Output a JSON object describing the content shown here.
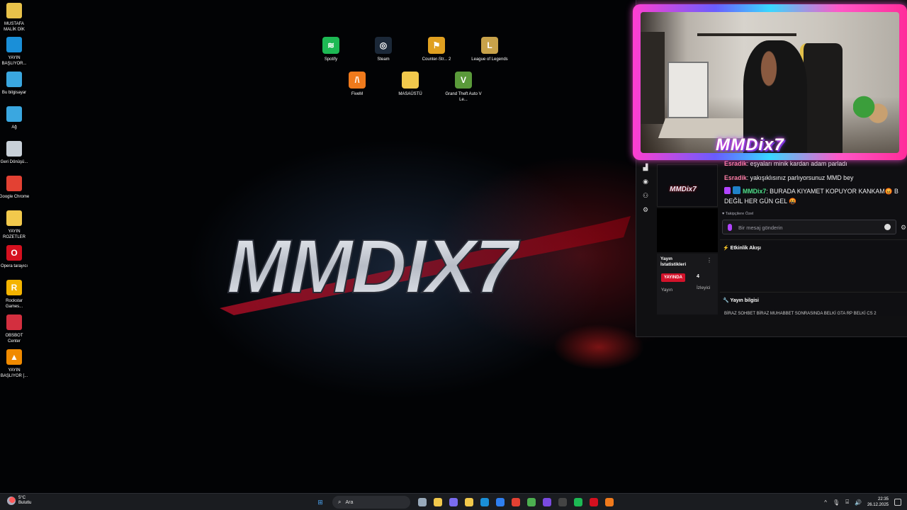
{
  "desktop": {
    "wallpaper_text": "MMDIX7",
    "left_icons": [
      {
        "label": "MUSTAFA MALİK DİK",
        "icon": "user-folder-icon",
        "color": "#e8c24a",
        "glyph": ""
      },
      {
        "label": "YAYIN BAŞLIYOR...",
        "icon": "edge-icon",
        "color": "#1a8fd8",
        "glyph": ""
      },
      {
        "label": "Bu bilgisayar",
        "icon": "computer-icon",
        "color": "#3aa7e0",
        "glyph": ""
      },
      {
        "label": "Ağ",
        "icon": "network-icon",
        "color": "#3aa7e0",
        "glyph": ""
      },
      {
        "label": "Geri Dönüşü...",
        "icon": "recycle-bin-icon",
        "color": "#c8d0d8",
        "glyph": ""
      },
      {
        "label": "Google Chrome",
        "icon": "chrome-icon",
        "color": "#e34133",
        "glyph": ""
      },
      {
        "label": "YAYIN ROZETLER",
        "icon": "folder-icon",
        "color": "#f2c94c",
        "glyph": ""
      },
      {
        "label": "Opera tarayıcı",
        "icon": "opera-icon",
        "color": "#d5101f",
        "glyph": "O"
      },
      {
        "label": "Rockstar Games...",
        "icon": "rockstar-icon",
        "color": "#f4b400",
        "glyph": "R"
      },
      {
        "label": "OBSBOT Center",
        "icon": "obsbot-icon",
        "color": "#d32f3f",
        "glyph": ""
      },
      {
        "label": "YAYIN BAŞLIYOR [...",
        "icon": "vlc-icon",
        "color": "#f08a00",
        "glyph": "▲"
      }
    ],
    "top_icons": [
      {
        "label": "Spotify",
        "icon": "spotify-icon",
        "color": "#1db954",
        "glyph": "≋"
      },
      {
        "label": "Steam",
        "icon": "steam-icon",
        "color": "#1b2838",
        "glyph": "◎"
      },
      {
        "label": "Counter-Str... 2",
        "icon": "cs2-icon",
        "color": "#e0a020",
        "glyph": "⚑"
      },
      {
        "label": "League of Legends",
        "icon": "lol-icon",
        "color": "#c8a24a",
        "glyph": "L"
      },
      {
        "label": "FiveM",
        "icon": "fivem-icon",
        "color": "#f07a1c",
        "glyph": "/\\"
      },
      {
        "label": "MASAÜSTÜ",
        "icon": "folder-icon",
        "color": "#f2c94c",
        "glyph": ""
      },
      {
        "label": "Grand Theft Auto V Le...",
        "icon": "gta-icon",
        "color": "#5a9a3a",
        "glyph": "V"
      }
    ]
  },
  "stream_panel": {
    "webcam_name": "MMDix7",
    "thumb_logo": "MMDix7",
    "stats": {
      "title": "Yayın İstatistikleri",
      "live_badge": "YAYINDA",
      "viewer_count": "4",
      "stream_label": "Yayın",
      "viewer_label": "İzleyici"
    },
    "chat": {
      "messages": [
        {
          "user": "Esradik",
          "text": ": eşyaları minik kardan adam parladı"
        },
        {
          "user": "Esradik",
          "text": ": yakışıklısınız parlıyorsunuz MMD bey"
        },
        {
          "user": "MMDix7",
          "text": ": BURADA KIYAMET KOPUYOR KANKAM😡 B"
        },
        {
          "user": "",
          "text": "DEĞİL HER GÜN GEL 🤬"
        }
      ],
      "mode_label": "Takipçilere Özel",
      "input_placeholder": "Bir mesaj gönderin"
    },
    "activity": {
      "title": "Etkinlik Akışı"
    },
    "info": {
      "title": "Yayın bilgisi",
      "text": "BİRAZ SOHBET BİRAZ MUHABBET SONRASINDA BELKİ GTA RP BELKİ CS 2"
    }
  },
  "taskbar": {
    "weather_temp": "5°C",
    "weather_desc": "Bulutlu",
    "search_placeholder": "Ara",
    "time": "22:35",
    "date": "26.12.2025",
    "apps": [
      {
        "icon": "widget-icon",
        "color": "#9ab"
      },
      {
        "icon": "file-explorer-icon",
        "color": "#f2c94c"
      },
      {
        "icon": "copilot-icon",
        "color": "#7a6cf0"
      },
      {
        "icon": "folder-icon",
        "color": "#f2c94c"
      },
      {
        "icon": "edge-icon",
        "color": "#1a8fd8"
      },
      {
        "icon": "store-icon",
        "color": "#2f7ff0"
      },
      {
        "icon": "chrome-icon",
        "color": "#e34133"
      },
      {
        "icon": "chrome-icon",
        "color": "#4caf50"
      },
      {
        "icon": "grid-app-icon",
        "color": "#7a4ae0"
      },
      {
        "icon": "obs-icon",
        "color": "#444"
      },
      {
        "icon": "spotify-icon",
        "color": "#1db954"
      },
      {
        "icon": "opera-icon",
        "color": "#d5101f"
      },
      {
        "icon": "fivem-icon",
        "color": "#f07a1c"
      }
    ]
  }
}
